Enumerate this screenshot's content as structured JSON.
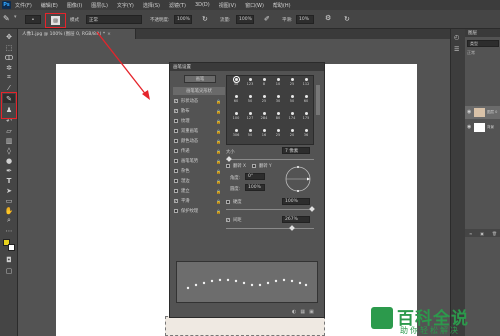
{
  "menubar": {
    "items": [
      "文件(F)",
      "编辑(E)",
      "图像(I)",
      "图层(L)",
      "文字(Y)",
      "选择(S)",
      "滤镜(T)",
      "3D(D)",
      "视图(V)",
      "窗口(W)",
      "帮助(H)"
    ]
  },
  "options": {
    "mode_label": "模式",
    "mode_value": "正常",
    "opacity_label": "不透明度:",
    "opacity_value": "100%",
    "flow_label": "流量:",
    "flow_value": "100%",
    "smooth_label": "平滑:",
    "smooth_value": "10%"
  },
  "tabs": [
    {
      "label": "人像1.jpg @ 100% (图层 0, RGB/8#) *"
    }
  ],
  "brush_panel": {
    "title": "画笔设置",
    "preset_button": "画笔",
    "tip_shape_label": "画笔笔尖形状",
    "settings": [
      {
        "label": "形状动态",
        "checked": true
      },
      {
        "label": "散布",
        "checked": true
      },
      {
        "label": "纹理",
        "checked": false
      },
      {
        "label": "双重画笔",
        "checked": false
      },
      {
        "label": "颜色动态",
        "checked": false
      },
      {
        "label": "传递",
        "checked": false
      },
      {
        "label": "画笔笔势",
        "checked": false
      },
      {
        "label": "杂色",
        "checked": false
      },
      {
        "label": "湿边",
        "checked": false
      },
      {
        "label": "建立",
        "checked": false
      },
      {
        "label": "平滑",
        "checked": true
      },
      {
        "label": "保护纹理",
        "checked": false
      }
    ],
    "tips": [
      {
        "size": "30"
      },
      {
        "size": "123"
      },
      {
        "size": "8"
      },
      {
        "size": "10"
      },
      {
        "size": "25"
      },
      {
        "size": "112"
      },
      {
        "size": "60"
      },
      {
        "size": "50"
      },
      {
        "size": "25"
      },
      {
        "size": "30"
      },
      {
        "size": "50"
      },
      {
        "size": "60"
      },
      {
        "size": "100"
      },
      {
        "size": "127"
      },
      {
        "size": "284"
      },
      {
        "size": "80"
      },
      {
        "size": "174"
      },
      {
        "size": "175"
      },
      {
        "size": "306"
      },
      {
        "size": "50"
      },
      {
        "size": "16"
      },
      {
        "size": "25"
      },
      {
        "size": "20"
      },
      {
        "size": "36"
      }
    ],
    "size_label": "大小",
    "size_value": "7 像素",
    "flip_x": "翻转 X",
    "flip_y": "翻转 Y",
    "angle_label": "角度:",
    "angle_value": "0°",
    "roundness_label": "圆度:",
    "roundness_value": "100%",
    "hardness_label": "硬度",
    "hardness_value": "100%",
    "spacing_label": "间距",
    "spacing_value": "267%"
  },
  "right_dock": {
    "layers_title": "图层",
    "kind_label": "类型",
    "layer_labels": [
      "正常",
      "图层 0",
      "背景"
    ]
  },
  "watermark": {
    "title": "百科全说",
    "subtitle": "助你轻松解决"
  }
}
